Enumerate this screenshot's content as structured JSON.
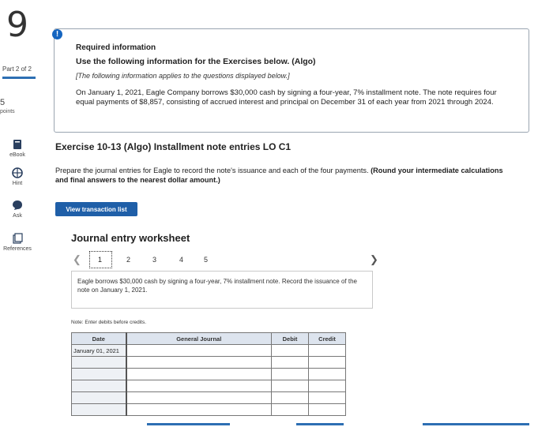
{
  "sidebar": {
    "question_number": "9",
    "part": "Part 2 of 2",
    "points_value": "5",
    "points_label": "points",
    "items": [
      {
        "label": "eBook"
      },
      {
        "label": "Hint"
      },
      {
        "label": "Ask"
      },
      {
        "label": "References"
      }
    ]
  },
  "info": {
    "title": "Required information",
    "use_line": "Use the following information for the Exercises below. (Algo)",
    "note": "[The following information applies to the questions displayed below.]",
    "paragraph": "On January 1, 2021, Eagle Company borrows $30,000 cash by signing a four-year, 7% installment note. The note requires four equal payments of $8,857, consisting of accrued interest and principal on December 31 of each year from 2021 through 2024."
  },
  "exercise": {
    "title": "Exercise 10-13 (Algo) Installment note entries LO C1",
    "prepare_text": "Prepare the journal entries for Eagle to record the note's issuance and each of the four payments. ",
    "prepare_bold": "(Round your intermediate calculations and final answers to the nearest dollar amount.)",
    "view_button": "View transaction list"
  },
  "worksheet": {
    "title": "Journal entry worksheet",
    "pages": [
      "1",
      "2",
      "3",
      "4",
      "5"
    ],
    "description": "Eagle borrows $30,000 cash by signing a four-year, 7% installment note. Record the issuance of the note on January 1, 2021.",
    "note": "Note: Enter debits before credits.",
    "columns": {
      "date": "Date",
      "journal": "General Journal",
      "debit": "Debit",
      "credit": "Credit"
    },
    "rows": [
      {
        "date": "January 01, 2021",
        "account": "",
        "debit": "",
        "credit": ""
      },
      {
        "date": "",
        "account": "",
        "debit": "",
        "credit": ""
      },
      {
        "date": "",
        "account": "",
        "debit": "",
        "credit": ""
      },
      {
        "date": "",
        "account": "",
        "debit": "",
        "credit": ""
      },
      {
        "date": "",
        "account": "",
        "debit": "",
        "credit": ""
      },
      {
        "date": "",
        "account": "",
        "debit": "",
        "credit": ""
      }
    ]
  },
  "colors": {
    "accent": "#1f5fa8",
    "alert": "#1565c0",
    "table_header": "#dde4ee"
  }
}
